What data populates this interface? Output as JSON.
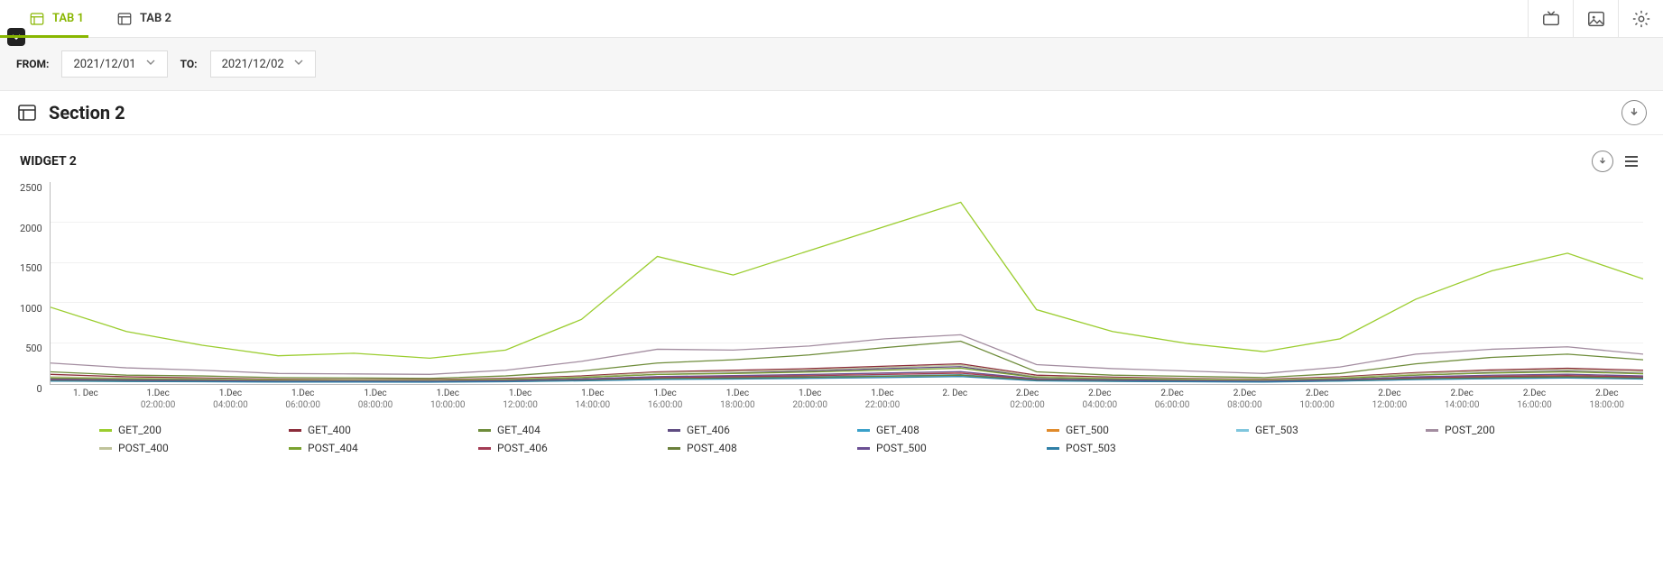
{
  "tabs": [
    {
      "id": "tab1",
      "label": "TAB 1",
      "active": true
    },
    {
      "id": "tab2",
      "label": "TAB 2",
      "active": false
    }
  ],
  "tab_underline_width": 98,
  "filters": {
    "from_label": "FROM:",
    "from_value": "2021/12/01",
    "to_label": "TO:",
    "to_value": "2021/12/02"
  },
  "section": {
    "title": "Section 2"
  },
  "widget": {
    "title": "WIDGET 2"
  },
  "chart_data": {
    "type": "line",
    "title": "",
    "xlabel": "",
    "ylabel": "",
    "ylim": [
      0,
      2500
    ],
    "yticks": [
      0,
      500,
      1000,
      1500,
      2000,
      2500
    ],
    "x": [
      0,
      1,
      2,
      3,
      4,
      5,
      6,
      7,
      8,
      9,
      10,
      11,
      12,
      13,
      14,
      15,
      16,
      17,
      18,
      19,
      20,
      21
    ],
    "xtick_labels": [
      {
        "l1": "1. Dec",
        "l2": ""
      },
      {
        "l1": "1.Dec",
        "l2": "02:00:00"
      },
      {
        "l1": "1.Dec",
        "l2": "04:00:00"
      },
      {
        "l1": "1.Dec",
        "l2": "06:00:00"
      },
      {
        "l1": "1.Dec",
        "l2": "08:00:00"
      },
      {
        "l1": "1.Dec",
        "l2": "10:00:00"
      },
      {
        "l1": "1.Dec",
        "l2": "12:00:00"
      },
      {
        "l1": "1.Dec",
        "l2": "14:00:00"
      },
      {
        "l1": "1.Dec",
        "l2": "16:00:00"
      },
      {
        "l1": "1.Dec",
        "l2": "18:00:00"
      },
      {
        "l1": "1.Dec",
        "l2": "20:00:00"
      },
      {
        "l1": "1.Dec",
        "l2": "22:00:00"
      },
      {
        "l1": "2. Dec",
        "l2": ""
      },
      {
        "l1": "2.Dec",
        "l2": "02:00:00"
      },
      {
        "l1": "2.Dec",
        "l2": "04:00:00"
      },
      {
        "l1": "2.Dec",
        "l2": "06:00:00"
      },
      {
        "l1": "2.Dec",
        "l2": "08:00:00"
      },
      {
        "l1": "2.Dec",
        "l2": "10:00:00"
      },
      {
        "l1": "2.Dec",
        "l2": "12:00:00"
      },
      {
        "l1": "2.Dec",
        "l2": "14:00:00"
      },
      {
        "l1": "2.Dec",
        "l2": "16:00:00"
      },
      {
        "l1": "2.Dec",
        "l2": "18:00:00"
      }
    ],
    "series": [
      {
        "name": "GET_200",
        "color": "#9bcd2f",
        "values": [
          950,
          650,
          480,
          350,
          380,
          320,
          420,
          800,
          1580,
          1350,
          1650,
          1950,
          2250,
          920,
          650,
          500,
          400,
          560,
          1050,
          1400,
          1620,
          1300
        ]
      },
      {
        "name": "GET_400",
        "color": "#8b2c3a",
        "values": [
          120,
          90,
          75,
          60,
          55,
          55,
          70,
          100,
          150,
          170,
          190,
          220,
          250,
          110,
          85,
          70,
          60,
          90,
          140,
          175,
          195,
          170
        ]
      },
      {
        "name": "GET_404",
        "color": "#6e8c3a",
        "values": [
          150,
          110,
          100,
          80,
          75,
          70,
          100,
          160,
          260,
          300,
          360,
          450,
          530,
          150,
          110,
          95,
          80,
          130,
          250,
          330,
          370,
          300
        ]
      },
      {
        "name": "GET_406",
        "color": "#5f4c82",
        "values": [
          70,
          55,
          50,
          40,
          38,
          38,
          50,
          80,
          120,
          135,
          160,
          190,
          215,
          85,
          60,
          50,
          42,
          70,
          110,
          140,
          160,
          130
        ]
      },
      {
        "name": "GET_408",
        "color": "#3aa0c9",
        "values": [
          45,
          38,
          35,
          30,
          30,
          30,
          36,
          50,
          70,
          80,
          90,
          100,
          115,
          50,
          40,
          35,
          30,
          45,
          68,
          82,
          92,
          78
        ]
      },
      {
        "name": "GET_500",
        "color": "#e08a2a",
        "values": [
          55,
          45,
          40,
          35,
          33,
          32,
          40,
          60,
          90,
          100,
          115,
          135,
          150,
          60,
          46,
          40,
          34,
          52,
          84,
          104,
          118,
          96
        ]
      },
      {
        "name": "GET_503",
        "color": "#7fc6dd",
        "values": [
          38,
          32,
          30,
          25,
          25,
          25,
          30,
          42,
          58,
          66,
          74,
          84,
          96,
          42,
          34,
          30,
          26,
          38,
          56,
          68,
          78,
          64
        ]
      },
      {
        "name": "POST_200",
        "color": "#a38da0",
        "values": [
          260,
          200,
          170,
          130,
          125,
          120,
          170,
          280,
          430,
          420,
          470,
          560,
          610,
          240,
          190,
          160,
          130,
          210,
          370,
          430,
          460,
          370
        ]
      },
      {
        "name": "POST_400",
        "color": "#bfc39a",
        "values": [
          90,
          72,
          64,
          52,
          50,
          48,
          60,
          90,
          140,
          155,
          175,
          205,
          235,
          95,
          74,
          62,
          52,
          80,
          130,
          160,
          180,
          150
        ]
      },
      {
        "name": "POST_404",
        "color": "#7aa22f",
        "values": [
          75,
          62,
          55,
          46,
          44,
          42,
          54,
          80,
          118,
          130,
          148,
          172,
          196,
          80,
          64,
          54,
          44,
          68,
          112,
          136,
          152,
          126
        ]
      },
      {
        "name": "POST_406",
        "color": "#a33b54",
        "values": [
          50,
          42,
          38,
          32,
          31,
          30,
          38,
          55,
          80,
          90,
          102,
          118,
          134,
          56,
          44,
          38,
          32,
          48,
          76,
          92,
          104,
          86
        ]
      },
      {
        "name": "POST_408",
        "color": "#6a7f3a",
        "values": [
          42,
          36,
          32,
          28,
          27,
          26,
          32,
          46,
          66,
          74,
          84,
          96,
          110,
          46,
          38,
          32,
          28,
          40,
          64,
          78,
          88,
          72
        ]
      },
      {
        "name": "POST_500",
        "color": "#6b4f93",
        "values": [
          60,
          50,
          44,
          36,
          35,
          34,
          42,
          62,
          92,
          104,
          118,
          136,
          154,
          64,
          50,
          42,
          36,
          54,
          88,
          108,
          122,
          100
        ]
      },
      {
        "name": "POST_503",
        "color": "#2f7fa6",
        "values": [
          36,
          31,
          28,
          24,
          24,
          23,
          28,
          40,
          56,
          62,
          70,
          80,
          92,
          40,
          32,
          28,
          24,
          36,
          54,
          66,
          74,
          62
        ]
      }
    ]
  }
}
